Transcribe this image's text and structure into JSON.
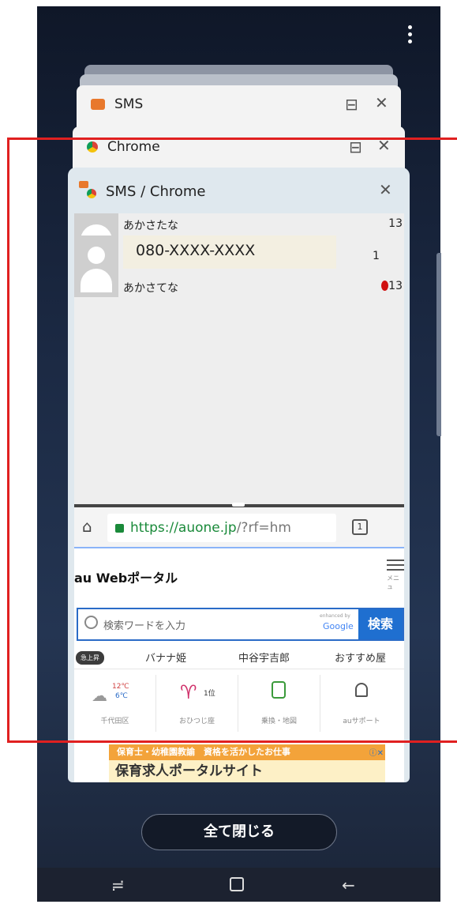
{
  "recents": {
    "more_menu_icon": "more-vertical-icon",
    "cards": [
      {
        "app": "SMS",
        "icon": "sms-app-icon"
      },
      {
        "app": "Chrome",
        "icon": "chrome-app-icon"
      }
    ],
    "split_card": {
      "title": "SMS / Chrome",
      "sms": {
        "rows": [
          {
            "name": "あかさたな",
            "count": "13"
          },
          {
            "number": "080-XXXX-XXXX",
            "count": "1"
          },
          {
            "name": "あかさてな",
            "count": "13"
          }
        ]
      },
      "chrome": {
        "url_secure": "https://auone.jp",
        "url_rest": "/?rf=hm",
        "tab_count": "1",
        "page": {
          "site_title": "au Webポータル",
          "menu_label": "メニュ",
          "search_placeholder": "検索ワードを入力",
          "search_button": "検索",
          "enhanced_by": "enhanced by",
          "google": "Google",
          "trending_badge": "急上昇",
          "trending": [
            "バナナ姫",
            "中谷宇吉郎",
            "おすすめ屋"
          ],
          "tiles": [
            {
              "label": "千代田区",
              "temp_high": "12℃",
              "temp_low": "6℃"
            },
            {
              "label": "おひつじ座",
              "rank": "1位"
            },
            {
              "label": "乗換・地図"
            },
            {
              "label": "auサポート"
            }
          ],
          "ad_top": "保育士・幼稚園教諭　資格を活かしたお仕事",
          "ad_title": "保育求人ポータルサイト"
        }
      }
    },
    "close_all": "全て閉じる"
  },
  "colors": {
    "highlight_box": "#e02020",
    "accent_blue": "#1f6fd0",
    "secure_green": "#1a8a3a"
  }
}
